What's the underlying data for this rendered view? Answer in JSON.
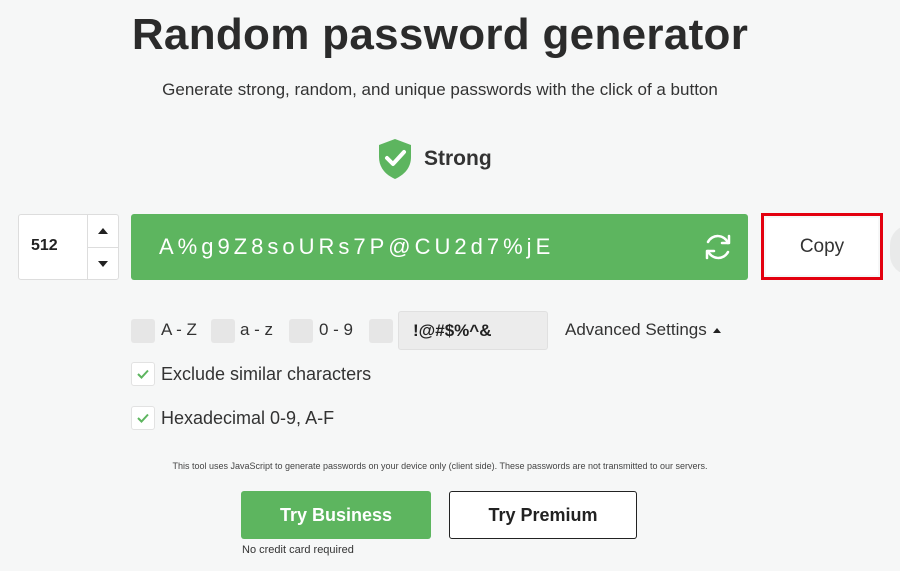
{
  "header": {
    "title": "Random password generator",
    "subtitle": "Generate strong, random, and unique passwords with the click of a button"
  },
  "strength": {
    "label": "Strong",
    "icon": "shield-check-icon",
    "color": "#5db55f"
  },
  "generator": {
    "length": "512",
    "password": "A%g9Z8soURs7P@CU2d7%jE",
    "copy_label": "Copy",
    "accent": "#5db55f",
    "highlight": "#e3000f"
  },
  "options": {
    "uppercase_label": "A - Z",
    "lowercase_label": "a - z",
    "digits_label": "0 - 9",
    "symbols_value": "!@#$%^&",
    "advanced_label": "Advanced Settings",
    "exclude_similar_label": "Exclude similar characters",
    "exclude_similar_checked": true,
    "hex_label": "Hexadecimal 0-9, A-F",
    "hex_checked": true
  },
  "footer": {
    "disclaimer": "This tool uses JavaScript to generate passwords on your device only (client side). These passwords are not transmitted to our servers.",
    "business_label": "Try Business",
    "premium_label": "Try Premium",
    "no_credit_card": "No credit card required"
  }
}
